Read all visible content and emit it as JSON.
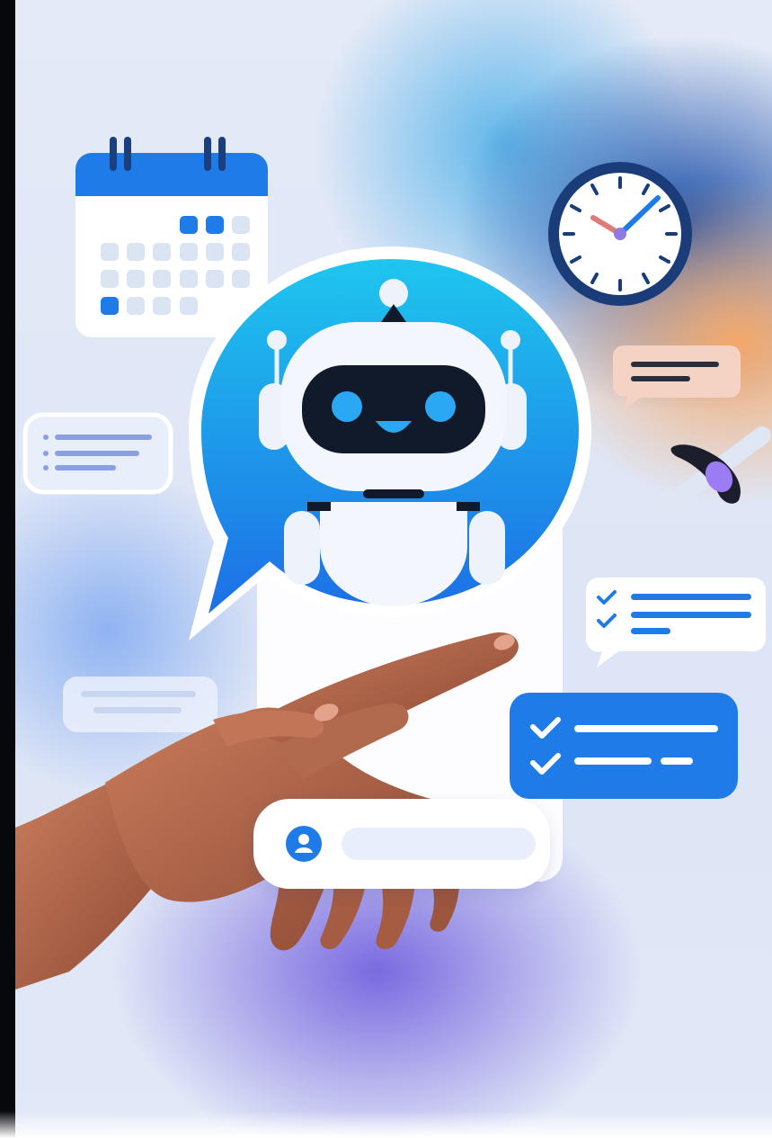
{
  "illustration": {
    "elements": [
      {
        "name": "calendar-icon",
        "kind": "calendar"
      },
      {
        "name": "clock-icon",
        "kind": "clock"
      },
      {
        "name": "chatbot-robot-icon",
        "kind": "robot-in-speech-bubble"
      },
      {
        "name": "chat-bubble-left",
        "kind": "placeholder-lines"
      },
      {
        "name": "chat-bubble-orange",
        "kind": "placeholder-lines"
      },
      {
        "name": "checklist-bubble-white",
        "kind": "checklist"
      },
      {
        "name": "checklist-bubble-blue",
        "kind": "checklist"
      },
      {
        "name": "pen-icon",
        "kind": "pen"
      },
      {
        "name": "hand-pointing",
        "kind": "hand"
      },
      {
        "name": "message-input-bar",
        "kind": "input"
      }
    ]
  },
  "colors": {
    "brand_blue": "#1f7be8",
    "robot_bubble_top": "#1ec6ee",
    "robot_bubble_bottom": "#1d6fe6",
    "robot_visor": "#111a2b",
    "robot_eye": "#2aa8f4",
    "clock_ring": "#1a3d7a",
    "orange_bubble": "#f4d3c4",
    "pen_purple": "#9b7cf2",
    "skin": "#b86a4e"
  }
}
